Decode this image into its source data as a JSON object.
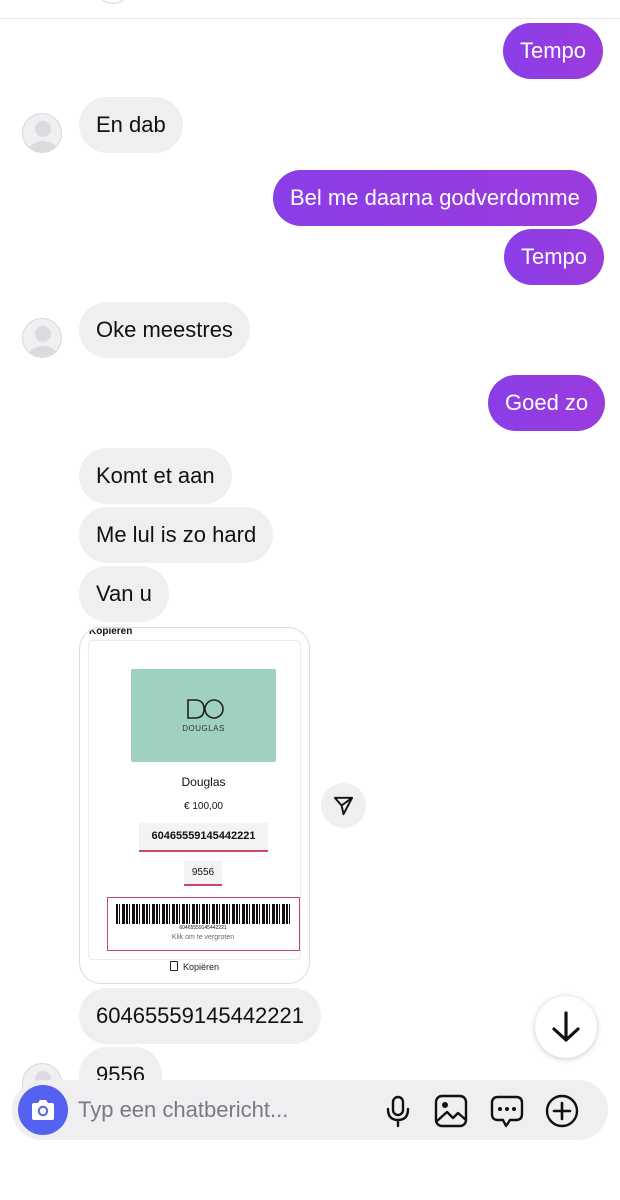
{
  "conversation": {
    "messages": [
      {
        "direction": "outgoing",
        "text": "Tempo"
      },
      {
        "direction": "incoming",
        "text": "En dab"
      },
      {
        "direction": "outgoing",
        "text": "Bel me daarna godverdomme"
      },
      {
        "direction": "outgoing",
        "text": "Tempo"
      },
      {
        "direction": "incoming",
        "text": "Oke meestres"
      },
      {
        "direction": "outgoing",
        "text": "Goed zo"
      },
      {
        "direction": "incoming",
        "text": "Komt et aan"
      },
      {
        "direction": "incoming",
        "text": "Me lul is zo hard"
      },
      {
        "direction": "incoming",
        "text": "Van u"
      },
      {
        "direction": "incoming",
        "text": "60465559145442221"
      },
      {
        "direction": "incoming",
        "text": "9556"
      }
    ]
  },
  "shared_card": {
    "header_label": "Kopiëren",
    "logo_text": "DOUGLAS",
    "brand": "Douglas",
    "amount": "€ 100,00",
    "card_number": "60465559145442221",
    "pin": "9556",
    "barcode_number": "60465559145442221",
    "barcode_hint": "Klik om te vergroten",
    "copy_label": "Kopiëren"
  },
  "composer": {
    "placeholder": "Typ een chatbericht..."
  },
  "icons": {
    "share": "share-arrow-icon",
    "scroll_down": "arrow-down-icon",
    "camera": "camera-icon",
    "microphone": "microphone-icon",
    "gallery": "image-icon",
    "quick_reply": "chat-bubble-dots-icon",
    "add": "plus-circle-icon"
  },
  "colors": {
    "outgoing_bubble": "#8a3ee8",
    "incoming_bubble": "#efeff2",
    "camera_button": "#5561f1",
    "card_accent": "#c94a62",
    "gift_card": "#9fd0c2"
  }
}
